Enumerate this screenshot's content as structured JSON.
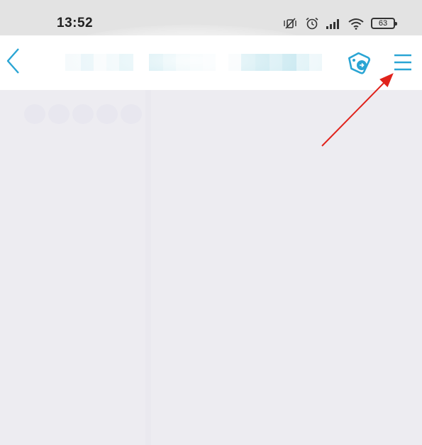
{
  "status_bar": {
    "time": "13:52",
    "battery_level": "63",
    "icons": [
      "mute-vibrate-icon",
      "alarm-icon",
      "signal-icon",
      "wifi-icon",
      "battery-icon"
    ]
  },
  "nav_bar": {
    "back_icon": "chevron-left-icon",
    "title": "",
    "share_icon": "share-tag-icon",
    "menu_icon": "hamburger-menu-icon"
  },
  "colors": {
    "accent": "#2aa5d4",
    "status_bar_bg": "#e3e3e3",
    "nav_bar_bg": "#ffffff",
    "content_bg": "#edecf1",
    "annotation_arrow": "#e0221b"
  }
}
